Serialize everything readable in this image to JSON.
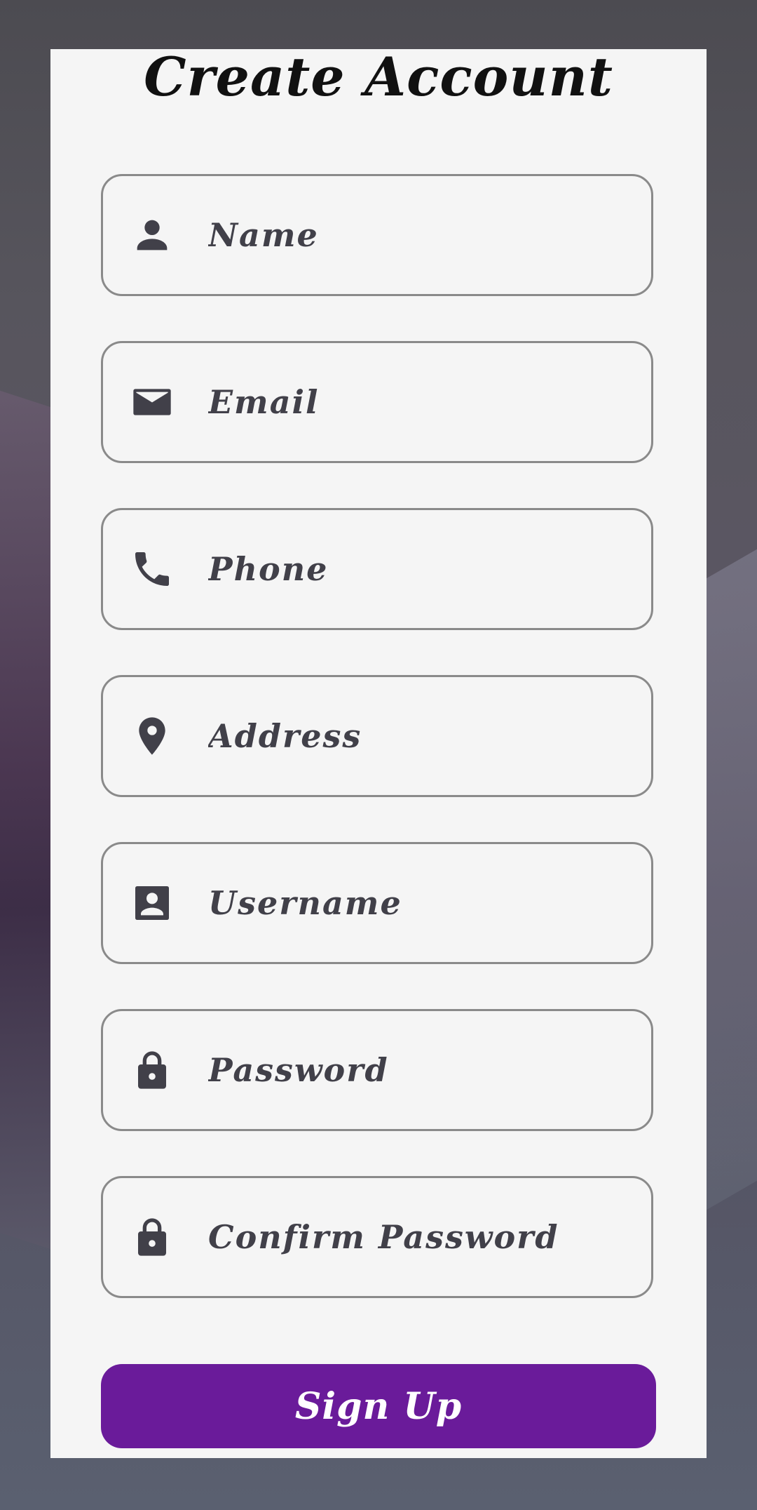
{
  "title": "Create Account",
  "fields": [
    {
      "icon": "person-icon",
      "placeholder": "Name",
      "value": ""
    },
    {
      "icon": "email-icon",
      "placeholder": "Email",
      "value": ""
    },
    {
      "icon": "phone-icon",
      "placeholder": "Phone",
      "value": ""
    },
    {
      "icon": "location-pin-icon",
      "placeholder": "Address",
      "value": ""
    },
    {
      "icon": "account-box-icon",
      "placeholder": "Username",
      "value": ""
    },
    {
      "icon": "lock-icon",
      "placeholder": "Password",
      "value": ""
    },
    {
      "icon": "lock-icon",
      "placeholder": "Confirm Password",
      "value": ""
    }
  ],
  "signup_label": "Sign Up",
  "colors": {
    "accent": "#6a1b9a",
    "card": "#f5f5f5",
    "icon": "#414049",
    "border": "#8a8a8a"
  }
}
